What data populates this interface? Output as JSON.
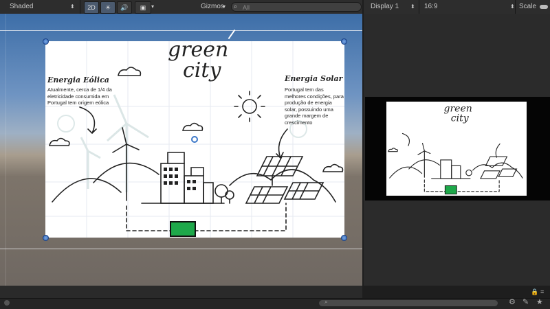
{
  "scene_toolbar": {
    "shading_mode": "Shaded",
    "mode_2d": "2D",
    "gizmos": "Gizmos",
    "search_placeholder": "All"
  },
  "game_toolbar": {
    "display": "Display 1",
    "aspect": "16:9",
    "scale": "Scale"
  },
  "canvas": {
    "title_line1": "green",
    "title_line2": "city",
    "wind_heading": "Energia Eólica",
    "wind_text": "Atualmente, cerca de 1/4 da eletricidade consumida em Portugal tem origem eólica",
    "solar_heading": "Energia Solar",
    "solar_text": "Portugal tem das melhores condições, para produção de energia solar, possuindo uma grande margem de crescimento"
  },
  "colors": {
    "battery": "#1ea84a",
    "handle": "#2d62b8",
    "toolbar": "#2d2d2d"
  }
}
